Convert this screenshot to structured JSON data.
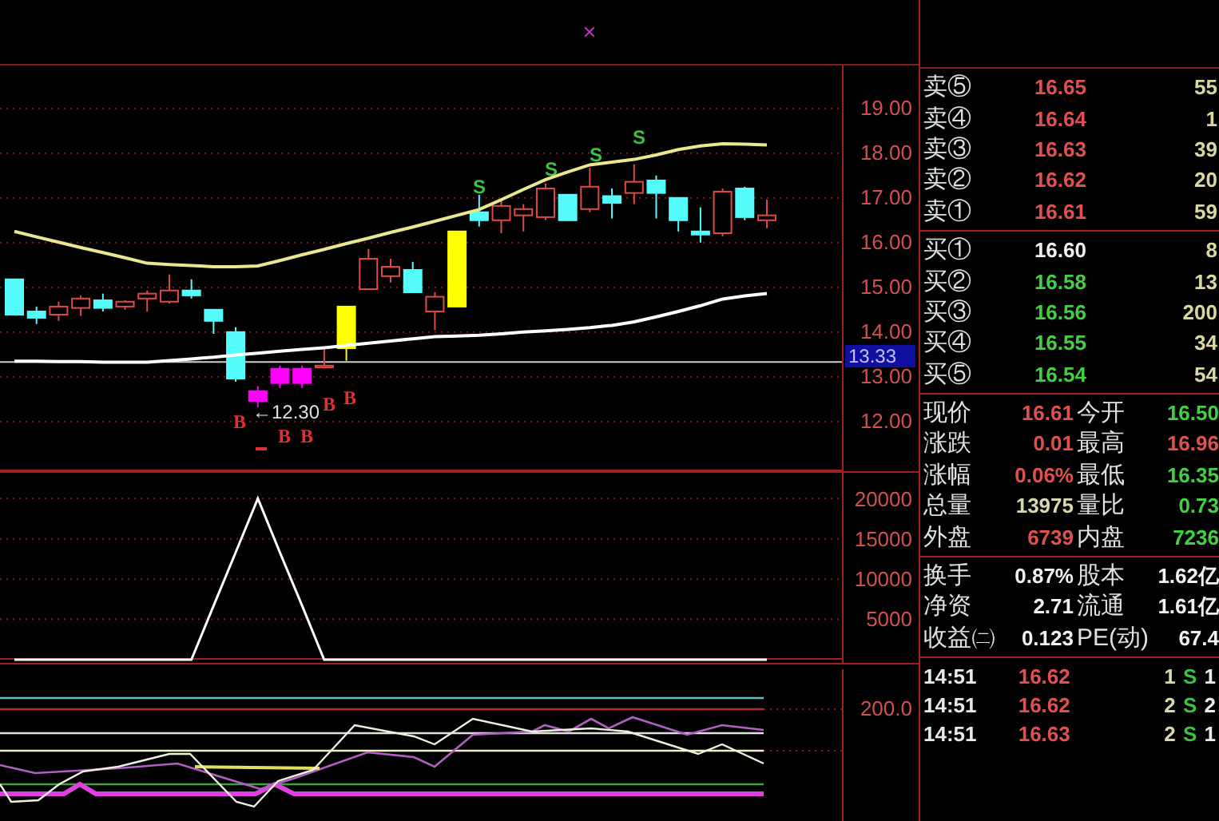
{
  "price_chart": {
    "chart_data": {
      "type": "candlestick",
      "ylim": [
        10.89,
        19.96
      ],
      "grid": true,
      "categories": [
        null,
        null,
        null,
        null,
        null,
        null,
        null,
        null,
        null,
        null,
        null,
        null,
        null,
        null,
        null,
        null,
        null,
        null,
        null,
        null,
        null,
        null,
        null,
        null,
        null,
        null,
        null,
        null,
        null,
        null,
        null,
        null,
        null,
        null,
        null
      ],
      "ref_lines": [
        {
          "axis": "y",
          "value": 13.33,
          "label": "13.33"
        }
      ],
      "ohlc": [
        [
          15.18,
          15.18,
          14.39,
          14.39
        ],
        [
          14.46,
          14.57,
          14.18,
          14.32
        ],
        [
          14.39,
          14.68,
          14.25,
          14.57
        ],
        [
          14.54,
          14.82,
          14.36,
          14.75
        ],
        [
          14.71,
          14.86,
          14.46,
          14.54
        ],
        [
          14.57,
          14.71,
          14.5,
          14.68
        ],
        [
          14.75,
          14.93,
          14.46,
          14.86
        ],
        [
          14.68,
          15.29,
          14.64,
          14.93
        ],
        [
          14.93,
          15.18,
          14.75,
          14.82
        ],
        [
          14.5,
          14.5,
          13.96,
          14.25
        ],
        [
          14.0,
          14.11,
          12.89,
          12.96
        ],
        [
          12.68,
          12.79,
          12.32,
          12.46
        ],
        [
          13.18,
          13.25,
          12.75,
          12.86
        ],
        [
          13.18,
          13.25,
          12.75,
          12.86
        ],
        [
          13.21,
          13.61,
          13.21,
          13.25
        ],
        [
          13.64,
          14.57,
          13.36,
          14.57
        ],
        [
          14.96,
          15.86,
          14.96,
          15.64
        ],
        [
          15.25,
          15.64,
          15.11,
          15.46
        ],
        [
          15.39,
          15.57,
          14.89,
          14.89
        ],
        [
          14.46,
          14.89,
          14.04,
          14.79
        ],
        [
          14.57,
          16.25,
          14.57,
          16.25
        ],
        [
          16.68,
          17.07,
          16.36,
          16.5
        ],
        [
          16.5,
          16.96,
          16.21,
          16.82
        ],
        [
          16.61,
          16.86,
          16.25,
          16.75
        ],
        [
          16.57,
          17.32,
          16.5,
          17.21
        ],
        [
          17.07,
          17.07,
          16.5,
          16.5
        ],
        [
          16.75,
          17.68,
          16.68,
          17.25
        ],
        [
          17.04,
          17.21,
          16.54,
          16.89
        ],
        [
          17.11,
          17.75,
          16.86,
          17.36
        ],
        [
          17.39,
          17.5,
          16.54,
          17.11
        ],
        [
          17.0,
          17.0,
          16.25,
          16.5
        ],
        [
          16.25,
          16.79,
          16.0,
          16.18
        ],
        [
          16.21,
          17.21,
          16.14,
          17.14
        ],
        [
          17.21,
          17.25,
          16.5,
          16.57
        ],
        [
          16.5,
          16.96,
          16.32,
          16.61
        ]
      ],
      "colors": [
        "#54fcfc",
        "#54fcfc",
        "#e04848",
        "#e04848",
        "#54fcfc",
        "#e04848",
        "#e04848",
        "#e04848",
        "#54fcfc",
        "#54fcfc",
        "#54fcfc",
        "#ff00ff",
        "#ff00ff",
        "#ff00ff",
        "#e04848",
        "#ffff00",
        "#e04848",
        "#e04848",
        "#54fcfc",
        "#e04848",
        "#ffff00",
        "#54fcfc",
        "#e04848",
        "#e04848",
        "#e04848",
        "#54fcfc",
        "#e04848",
        "#54fcfc",
        "#e04848",
        "#54fcfc",
        "#54fcfc",
        "#54fcfc",
        "#e04848",
        "#54fcfc",
        "#e04848"
      ],
      "yticks": [
        {
          "value": 19,
          "label": "19.00"
        },
        {
          "value": 18,
          "label": "18.00"
        },
        {
          "value": 17,
          "label": "17.00"
        },
        {
          "value": 16,
          "label": "16.00"
        },
        {
          "value": 15,
          "label": "15.00"
        },
        {
          "value": 14,
          "label": "14.00"
        },
        {
          "value": 13,
          "label": "13.00"
        },
        {
          "value": 12,
          "label": "12.00"
        }
      ],
      "series": [
        {
          "type": "line",
          "color": "#e8e890",
          "values": [
            16.25,
            16.13,
            16.01,
            15.89,
            15.78,
            15.66,
            15.54,
            15.51,
            15.49,
            15.46,
            15.46,
            15.48,
            15.6,
            15.73,
            15.85,
            15.98,
            16.1,
            16.23,
            16.35,
            16.48,
            16.61,
            16.74,
            16.96,
            17.19,
            17.41,
            17.58,
            17.74,
            17.8,
            17.86,
            17.96,
            18.08,
            18.16,
            18.21,
            18.2,
            18.18
          ]
        },
        {
          "type": "line",
          "color": "#ffffff",
          "values": [
            13.35,
            13.35,
            13.34,
            13.34,
            13.33,
            13.33,
            13.33,
            13.36,
            13.4,
            13.44,
            13.49,
            13.53,
            13.57,
            13.61,
            13.65,
            13.7,
            13.75,
            13.8,
            13.85,
            13.9,
            13.91,
            13.93,
            13.96,
            14.0,
            14.03,
            14.06,
            14.1,
            14.15,
            14.23,
            14.34,
            14.46,
            14.59,
            14.74,
            14.81,
            14.86
          ]
        }
      ]
    },
    "low_label": "←12.30",
    "signals": [
      {
        "text": "S",
        "kind": "sell"
      },
      {
        "text": "S",
        "kind": "sell"
      },
      {
        "text": "S",
        "kind": "sell"
      },
      {
        "text": "S",
        "kind": "sell"
      },
      {
        "text": "B",
        "kind": "buy"
      },
      {
        "text": "B",
        "kind": "buy"
      },
      {
        "text": "B",
        "kind": "buy"
      },
      {
        "text": "B",
        "kind": "buy"
      },
      {
        "text": "B",
        "kind": "buy"
      }
    ]
  },
  "volume_chart": {
    "chart_data": {
      "type": "line",
      "ylim": [
        0,
        23000
      ],
      "grid": true,
      "categories": [
        null,
        null,
        null,
        null,
        null,
        null,
        null,
        null,
        null,
        null,
        null,
        null,
        null,
        null,
        null,
        null,
        null,
        null,
        null,
        null,
        null,
        null,
        null,
        null,
        null,
        null,
        null,
        null,
        null,
        null,
        null,
        null,
        null,
        null,
        null
      ],
      "yticks": [
        {
          "value": 20000,
          "label": "20000"
        },
        {
          "value": 15000,
          "label": "15000"
        },
        {
          "value": 10000,
          "label": "10000"
        },
        {
          "value": 5000,
          "label": "5000"
        }
      ],
      "series": [
        {
          "color": "#ffffff",
          "values": [
            0,
            0,
            0,
            0,
            0,
            0,
            0,
            0,
            0,
            6700,
            13300,
            20000,
            13300,
            6700,
            0,
            0,
            0,
            0,
            0,
            0,
            0,
            0,
            0,
            0,
            0,
            0,
            0,
            0,
            0,
            0,
            0,
            0,
            0,
            0,
            0
          ]
        }
      ]
    }
  },
  "indicator_chart": {
    "axis_labels": [
      "200.0"
    ]
  },
  "order_book": {
    "asks": [
      {
        "label": "卖⑤",
        "price": "16.65",
        "color": "#e05050",
        "volume": "55"
      },
      {
        "label": "卖④",
        "price": "16.64",
        "color": "#e05050",
        "volume": "1"
      },
      {
        "label": "卖③",
        "price": "16.63",
        "color": "#e05050",
        "volume": "39"
      },
      {
        "label": "卖②",
        "price": "16.62",
        "color": "#e05050",
        "volume": "20"
      },
      {
        "label": "卖①",
        "price": "16.61",
        "color": "#e05050",
        "volume": "59"
      }
    ],
    "bids": [
      {
        "label": "买①",
        "price": "16.60",
        "color": "#f0f0f0",
        "volume": "8"
      },
      {
        "label": "买②",
        "price": "16.58",
        "color": "#40d040",
        "volume": "13"
      },
      {
        "label": "买③",
        "price": "16.56",
        "color": "#40d040",
        "volume": "200"
      },
      {
        "label": "买④",
        "price": "16.55",
        "color": "#40d040",
        "volume": "34"
      },
      {
        "label": "买⑤",
        "price": "16.54",
        "color": "#40d040",
        "volume": "54"
      }
    ]
  },
  "quote_stats": [
    {
      "cells": [
        {
          "label": "现价",
          "value": "16.61",
          "color": "#e05050"
        },
        {
          "label": "今开",
          "value": "16.50",
          "color": "#40d040"
        }
      ]
    },
    {
      "cells": [
        {
          "label": "涨跌",
          "value": "0.01",
          "color": "#e05050"
        },
        {
          "label": "最高",
          "value": "16.96",
          "color": "#e05050"
        }
      ]
    },
    {
      "cells": [
        {
          "label": "涨幅",
          "value": "0.06%",
          "color": "#e05050"
        },
        {
          "label": "最低",
          "value": "16.35",
          "color": "#40d040"
        }
      ]
    },
    {
      "cells": [
        {
          "label": "总量",
          "value": "13975",
          "color": "#d8d8b0"
        },
        {
          "label": "量比",
          "value": "0.73",
          "color": "#40d040"
        }
      ]
    },
    {
      "cells": [
        {
          "label": "外盘",
          "value": "6739",
          "color": "#e05050"
        },
        {
          "label": "内盘",
          "value": "7236",
          "color": "#40d040"
        }
      ]
    }
  ],
  "share_stats": [
    {
      "cells": [
        {
          "label": "换手",
          "value": "0.87%",
          "color": "#f0f0f0"
        },
        {
          "label": "股本",
          "value": "1.62亿",
          "color": "#f0f0f0"
        }
      ]
    },
    {
      "cells": [
        {
          "label": "净资",
          "value": "2.71",
          "color": "#f0f0f0"
        },
        {
          "label": "流通",
          "value": "1.61亿",
          "color": "#f0f0f0"
        }
      ]
    },
    {
      "cells": [
        {
          "label": "收益㈡",
          "value": "0.123",
          "color": "#f0f0f0"
        },
        {
          "label": "PE(动)",
          "value": "67.4",
          "color": "#f0f0f0"
        }
      ]
    }
  ],
  "trades": [
    {
      "time": "14:51",
      "price": "16.62",
      "color": "#e05050",
      "volume": "1",
      "side": "S",
      "count": "1"
    },
    {
      "time": "14:51",
      "price": "16.62",
      "color": "#e05050",
      "volume": "2",
      "side": "S",
      "count": "2"
    },
    {
      "time": "14:51",
      "price": "16.63",
      "color": "#e05050",
      "volume": "2",
      "side": "S",
      "count": "1"
    }
  ]
}
